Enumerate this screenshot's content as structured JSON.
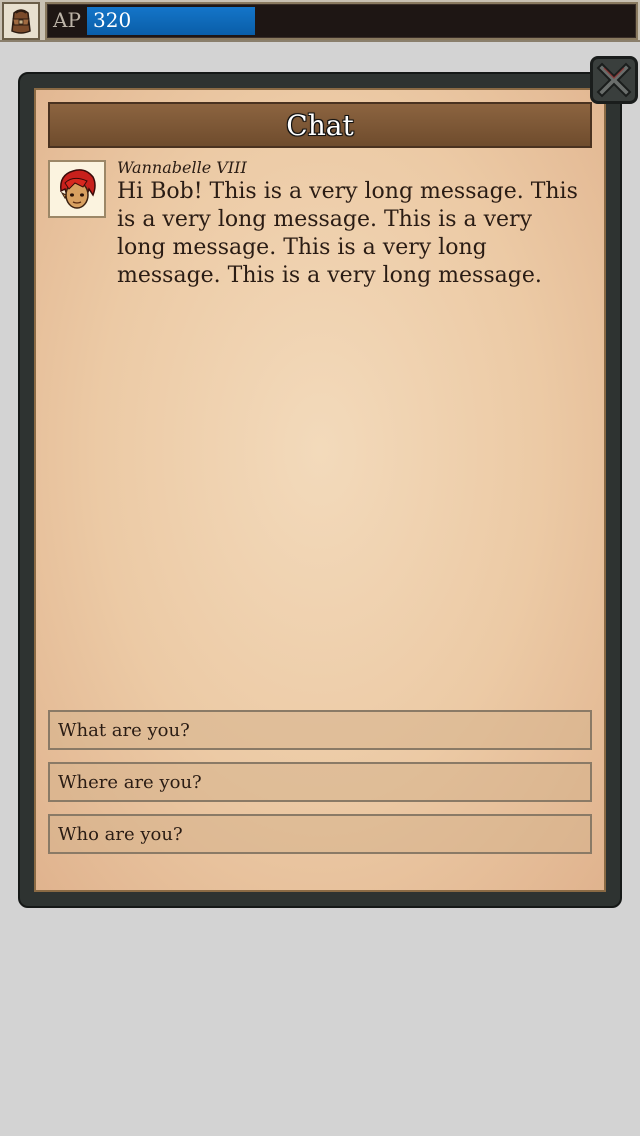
{
  "topbar": {
    "inventory_icon": "satchel-icon",
    "ap_label": "AP",
    "ap_value": "320",
    "ap_fill_fraction": 0.307,
    "ap_bar_color": "#0d65b4"
  },
  "dialog": {
    "title": "Chat",
    "close_icon": "close-icon"
  },
  "message": {
    "sender": "Wannabelle VIII",
    "avatar_icon": "red-haired-character-portrait",
    "text": "Hi Bob! This is a very long message. This is a very long message. This is a very long message. This is a very long message. This is a very long message."
  },
  "options": [
    {
      "label": "What are you?"
    },
    {
      "label": "Where are you?"
    },
    {
      "label": "Who are you?"
    }
  ]
}
